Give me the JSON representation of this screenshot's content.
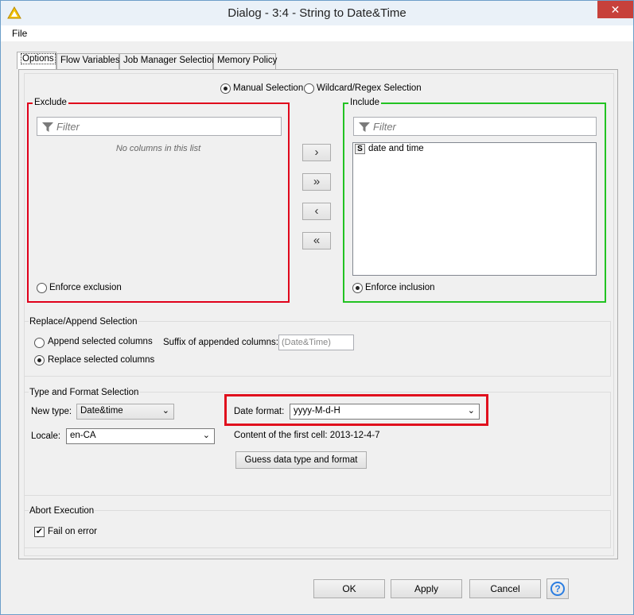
{
  "window": {
    "title": "Dialog - 3:4 - String to Date&Time",
    "close_glyph": "✕"
  },
  "menu": {
    "file": "File"
  },
  "tabs": [
    {
      "label": "Options",
      "active": true
    },
    {
      "label": "Flow Variables"
    },
    {
      "label": "Job Manager Selection"
    },
    {
      "label": "Memory Policy"
    }
  ],
  "selection_mode": {
    "manual": "Manual Selection",
    "wildcard": "Wildcard/Regex Selection",
    "selected": "manual"
  },
  "exclude": {
    "title": "Exclude",
    "filter_placeholder": "Filter",
    "empty_text": "No columns in this list",
    "enforce_label": "Enforce exclusion",
    "enforce_selected": false
  },
  "include": {
    "title": "Include",
    "filter_placeholder": "Filter",
    "columns": [
      {
        "type_badge": "S",
        "name": "date and time"
      }
    ],
    "enforce_label": "Enforce inclusion",
    "enforce_selected": true
  },
  "move_buttons": {
    "add": "›",
    "add_all": "»",
    "remove": "‹",
    "remove_all": "«"
  },
  "replace_append": {
    "title": "Replace/Append Selection",
    "append_label": "Append selected columns",
    "replace_label": "Replace selected columns",
    "selected": "replace",
    "suffix_label": "Suffix of appended columns:",
    "suffix_value": "(Date&Time)"
  },
  "type_format": {
    "title": "Type and Format Selection",
    "new_type_label": "New type:",
    "new_type_value": "Date&time",
    "locale_label": "Locale:",
    "locale_value": "en-CA",
    "date_format_label": "Date format:",
    "date_format_value": "yyyy-M-d-H",
    "first_cell_text": "Content of the first cell: 2013-12-4-7",
    "guess_button": "Guess data type and format"
  },
  "abort": {
    "title": "Abort Execution",
    "fail_label": "Fail on error",
    "fail_checked": true
  },
  "footer": {
    "ok": "OK",
    "apply": "Apply",
    "cancel": "Cancel",
    "help": "?"
  },
  "colors": {
    "exclude_border": "#e0001b",
    "include_border": "#22c322",
    "highlight_border": "#e0101d",
    "help_blue": "#2a7de1"
  }
}
